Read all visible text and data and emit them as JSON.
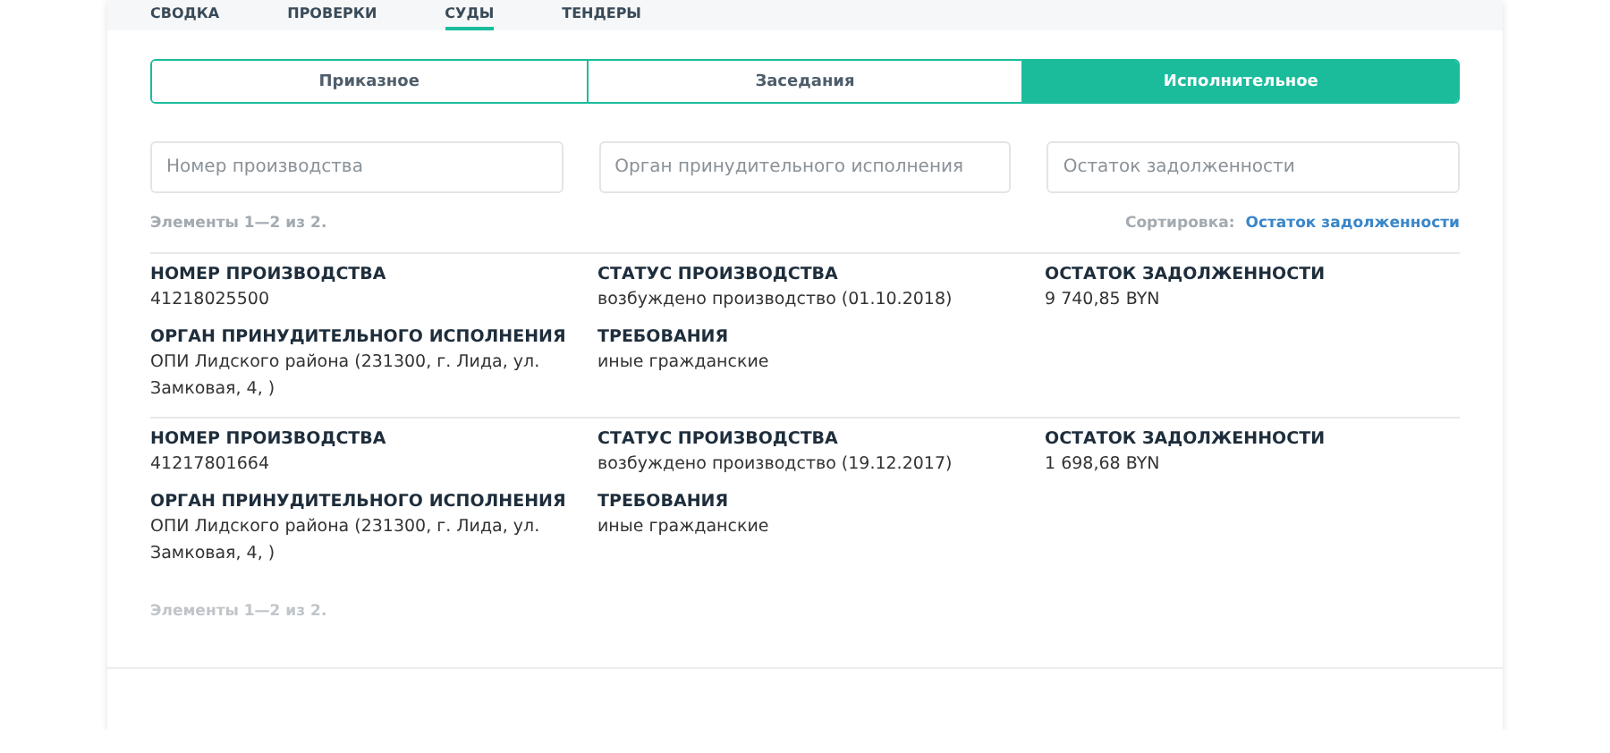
{
  "top_tabs": [
    {
      "label": "СВОДКА",
      "selected": false
    },
    {
      "label": "ПРОВЕРКИ",
      "selected": false
    },
    {
      "label": "СУДЫ",
      "selected": true
    },
    {
      "label": "ТЕНДЕРЫ",
      "selected": false
    }
  ],
  "segments": [
    {
      "label": "Приказное",
      "selected": false
    },
    {
      "label": "Заседания",
      "selected": false
    },
    {
      "label": "Исполнительное",
      "selected": true
    }
  ],
  "filters": [
    {
      "placeholder": "Номер производства"
    },
    {
      "placeholder": "Орган принудительного исполнения"
    },
    {
      "placeholder": "Остаток задолженности"
    }
  ],
  "count": "Элементы 1—2 из 2.",
  "sort": {
    "label": "Сортировка:",
    "value": "Остаток задолженности"
  },
  "records": [
    {
      "fields": [
        {
          "label": "НОМЕР ПРОИЗВОДСТВА",
          "value": "41218025500"
        },
        {
          "label": "СТАТУС ПРОИЗВОДСТВА",
          "value": "возбуждено производство (01.10.2018)"
        },
        {
          "label": "ОСТАТОК ЗАДОЛЖЕННОСТИ",
          "value": "9 740,85 BYN"
        },
        {
          "label": "ОРГАН ПРИНУДИТЕЛЬНОГО ИСПОЛНЕНИЯ",
          "value": "ОПИ Лидского района (231300, г. Лида, ул. Замковая, 4, )"
        },
        {
          "label": "ТРЕБОВАНИЯ",
          "value": "иные гражданские"
        }
      ]
    },
    {
      "fields": [
        {
          "label": "НОМЕР ПРОИЗВОДСТВА",
          "value": "41217801664"
        },
        {
          "label": "СТАТУС ПРОИЗВОДСТВА",
          "value": "возбуждено производство (19.12.2017)"
        },
        {
          "label": "ОСТАТОК ЗАДОЛЖЕННОСТИ",
          "value": "1 698,68 BYN"
        },
        {
          "label": "ОРГАН ПРИНУДИТЕЛЬНОГО ИСПОЛНЕНИЯ",
          "value": "ОПИ Лидского района (231300, г. Лида, ул. Замковая, 4, )"
        },
        {
          "label": "ТРЕБОВАНИЯ",
          "value": "иные гражданские"
        }
      ]
    }
  ],
  "footer_count": "Элементы 1—2 из 2."
}
